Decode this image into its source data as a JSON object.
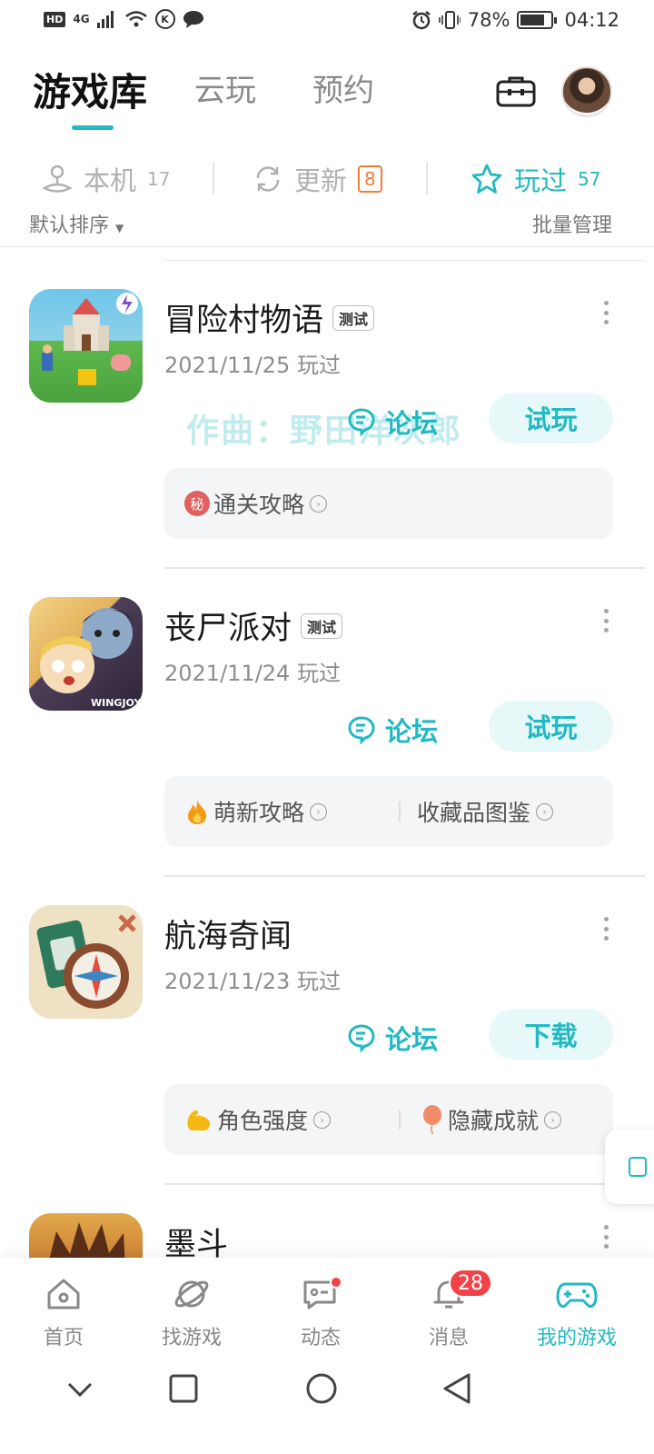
{
  "status_bar": {
    "hd": "HD",
    "network": "4G",
    "k_icon": "K",
    "battery": "78%",
    "time": "04:12"
  },
  "tabs": [
    {
      "label": "游戏库",
      "active": true
    },
    {
      "label": "云玩",
      "active": false
    },
    {
      "label": "预约",
      "active": false
    }
  ],
  "filters": {
    "local": {
      "label": "本机",
      "count": "17"
    },
    "update": {
      "label": "更新",
      "count": "8"
    },
    "played": {
      "label": "玩过",
      "count": "57"
    }
  },
  "sort": {
    "label": "默认排序",
    "batch": "批量管理"
  },
  "watermark": "作曲：野田洋次郎",
  "games": [
    {
      "name": "冒险村物语",
      "tag": "测试",
      "date": "2021/11/25 玩过",
      "forum": "论坛",
      "action": "试玩",
      "guides": [
        {
          "emoji": "秘",
          "label": "通关攻略"
        }
      ]
    },
    {
      "name": "丧尸派对",
      "tag": "测试",
      "date": "2021/11/24 玩过",
      "forum": "论坛",
      "action": "试玩",
      "guides": [
        {
          "emoji": "fire",
          "label": "萌新攻略"
        },
        {
          "emoji": "",
          "label": "收藏品图鉴"
        }
      ]
    },
    {
      "name": "航海奇闻",
      "tag": "",
      "date": "2021/11/23 玩过",
      "forum": "论坛",
      "action": "下载",
      "guides": [
        {
          "emoji": "muscle",
          "label": "角色强度"
        },
        {
          "emoji": "balloon",
          "label": "隐藏成就"
        }
      ]
    },
    {
      "name": "墨斗",
      "tag": "",
      "date": "",
      "forum": "",
      "action": "",
      "guides": []
    }
  ],
  "bottom_nav": [
    {
      "label": "首页",
      "icon": "home-icon"
    },
    {
      "label": "找游戏",
      "icon": "planet-icon"
    },
    {
      "label": "动态",
      "icon": "chat-icon",
      "dot": true
    },
    {
      "label": "消息",
      "icon": "bell-icon",
      "badge": "28"
    },
    {
      "label": "我的游戏",
      "icon": "gamepad-icon",
      "active": true
    }
  ],
  "colors": {
    "accent": "#22b9c2",
    "badge_red": "#f1424a",
    "update_orange": "#f07d3a"
  }
}
